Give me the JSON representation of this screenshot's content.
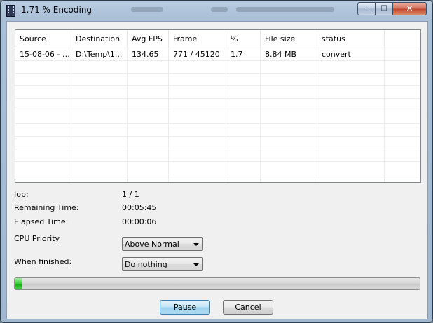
{
  "window": {
    "title": "1.71 % Encoding",
    "minimize_glyph": "–",
    "maximize_glyph": "□",
    "close_glyph": "✕"
  },
  "table": {
    "columns": [
      "Source",
      "Destination",
      "Avg FPS",
      "Frame",
      "%",
      "File size",
      "status"
    ],
    "rows": [
      {
        "source": "15-08-06 - T...",
        "destination": "D:\\Temp\\1...",
        "avg_fps": "134.65",
        "frame": "771 / 45120",
        "percent": "1.7",
        "file_size": "8.84 MB",
        "status": "convert"
      }
    ]
  },
  "info": {
    "job_label": "Job:",
    "job_value": "1 / 1",
    "remaining_label": "Remaining Time:",
    "remaining_value": "00:05:45",
    "elapsed_label": "Elapsed Time:",
    "elapsed_value": "00:00:06"
  },
  "cpu_priority": {
    "label": "CPU Priority",
    "selected": "Above Normal"
  },
  "when_finished": {
    "label": "When finished:",
    "selected": "Do nothing"
  },
  "progress": {
    "fraction": 0.0171,
    "color": "#22b422"
  },
  "buttons": {
    "pause": "Pause",
    "cancel": "Cancel"
  }
}
